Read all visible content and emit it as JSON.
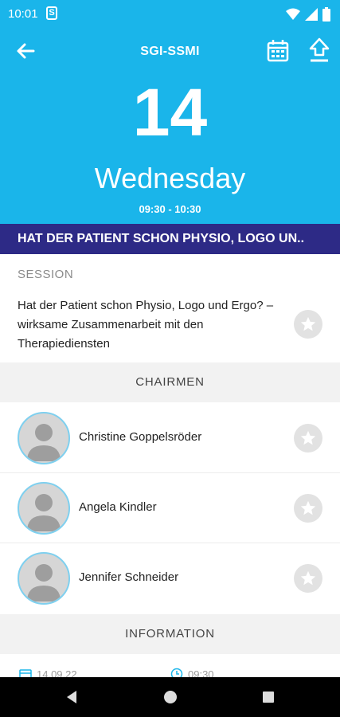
{
  "status_bar": {
    "time": "10:01",
    "app_icon_letter": "S"
  },
  "header": {
    "title": "SGI-SSMI",
    "day_number": "14",
    "day_name": "Wednesday",
    "time_range": "09:30 - 10:30",
    "bg_color": "#1ab5ea"
  },
  "banner": {
    "text": "HAT DER PATIENT SCHON PHYSIO, LOGO UN..",
    "bg_color": "#2d2a86"
  },
  "session": {
    "label": "SESSION",
    "text": "Hat der Patient schon Physio, Logo und Ergo? – wirksame Zusammenarbeit mit den Therapiediensten"
  },
  "chairmen": {
    "header": "CHAIRMEN",
    "people": [
      {
        "name": "Christine Goppelsröder"
      },
      {
        "name": "Angela Kindler"
      },
      {
        "name": "Jennifer Schneider"
      }
    ]
  },
  "information": {
    "header": "INFORMATION",
    "date": "14.09.22",
    "time": "09:30"
  },
  "icons": {
    "back": "arrow-left-icon",
    "calendar": "calendar-icon",
    "share": "share-upload-icon",
    "star": "star-icon"
  }
}
